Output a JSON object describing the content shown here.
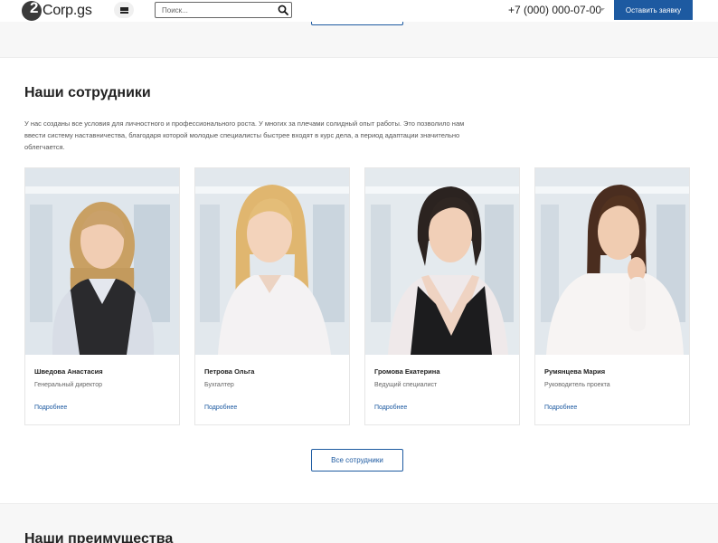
{
  "header": {
    "logo_text": "Corp.gs",
    "search_placeholder": "Поиск...",
    "phone": "+7 (000) 000-07-00",
    "cta_label": "Оставить заявку"
  },
  "employees_section": {
    "title": "Наши сотрудники",
    "description": "У нас созданы все условия для личностного и профессионального роста. У многих за плечами солидный опыт работы. Это позволило нам ввести систему наставничества, благодаря которой молодые специалисты быстрее входят в курс дела, а период адаптации значительно облегчается.",
    "employees": [
      {
        "name": "Шведова Анастасия",
        "role": "Генеральный директор",
        "link": "Подробнее"
      },
      {
        "name": "Петрова Ольга",
        "role": "Бухгалтер",
        "link": "Подробнее"
      },
      {
        "name": "Громова Екатерина",
        "role": "Ведущий специалист",
        "link": "Подробнее"
      },
      {
        "name": "Румянцева Мария",
        "role": "Руководитель проекта",
        "link": "Подробнее"
      }
    ],
    "all_button": "Все сотрудники"
  },
  "advantages_section": {
    "title": "Наши преимущества"
  },
  "colors": {
    "accent": "#1d5aa1",
    "section_bg": "#f7f7f7"
  }
}
